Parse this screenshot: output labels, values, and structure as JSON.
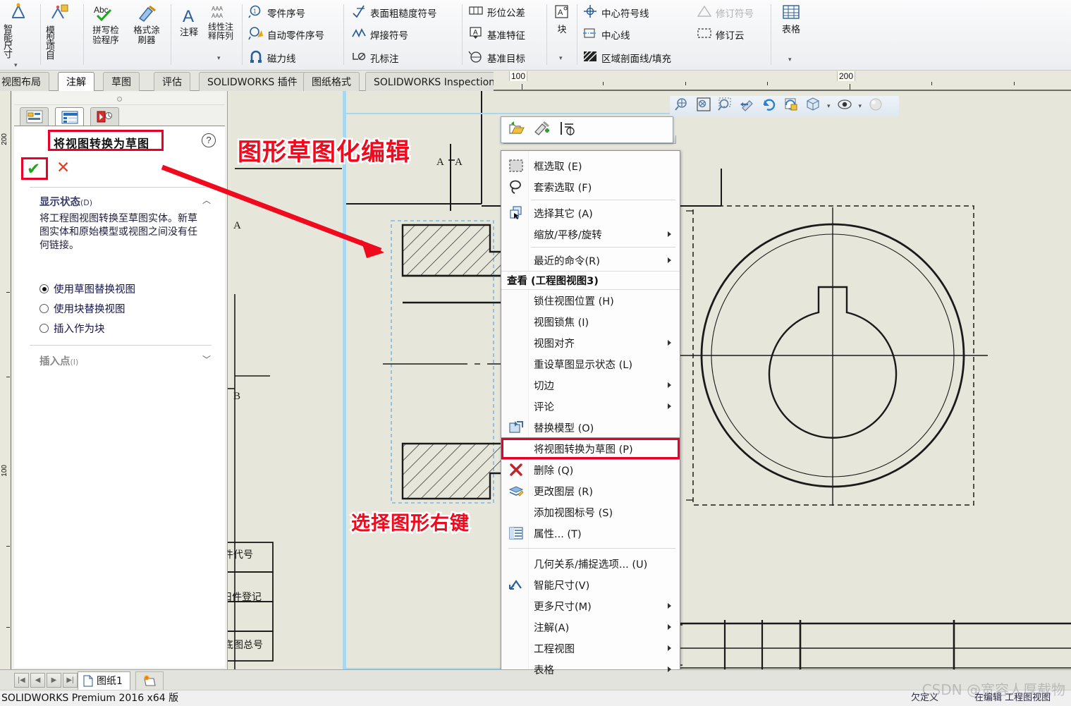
{
  "ribbon": {
    "groups": [
      {
        "label": "智能尺寸",
        "icon": "smart-dimension-icon",
        "has_dropdown": true
      },
      {
        "label": "模型项目",
        "icon": "model-items-icon",
        "has_dropdown": false
      },
      {
        "label": "拼写检验程序",
        "icon": "spell-check-icon",
        "has_dropdown": false
      },
      {
        "label": "格式涂刷器",
        "icon": "format-painter-icon",
        "has_dropdown": false
      },
      {
        "label": "注释",
        "icon": "note-icon",
        "has_dropdown": false
      },
      {
        "label": "线性注释阵列",
        "icon": "linear-note-pattern-icon",
        "has_dropdown": true
      },
      {
        "label": "块",
        "icon": "block-icon",
        "has_dropdown": true
      },
      {
        "label": "表格",
        "icon": "table-icon",
        "has_dropdown": true
      }
    ],
    "commands": [
      {
        "label": "零件序号",
        "icon": "balloon-icon",
        "disabled": false
      },
      {
        "label": "自动零件序号",
        "icon": "auto-balloon-icon",
        "disabled": false
      },
      {
        "label": "磁力线",
        "icon": "magnetic-line-icon",
        "disabled": false
      },
      {
        "label": "表面粗糙度符号",
        "icon": "surface-finish-icon",
        "disabled": false
      },
      {
        "label": "焊接符号",
        "icon": "weld-symbol-icon",
        "disabled": false
      },
      {
        "label": "孔标注",
        "icon": "hole-callout-icon",
        "disabled": false
      },
      {
        "label": "形位公差",
        "icon": "geometric-tolerance-icon",
        "disabled": false
      },
      {
        "label": "基准特征",
        "icon": "datum-feature-icon",
        "disabled": false
      },
      {
        "label": "基准目标",
        "icon": "datum-target-icon",
        "disabled": false
      },
      {
        "label": "中心符号线",
        "icon": "center-mark-icon",
        "disabled": false
      },
      {
        "label": "中心线",
        "icon": "centerline-icon",
        "disabled": false
      },
      {
        "label": "区域剖面线/填充",
        "icon": "area-hatch-fill-icon",
        "disabled": false
      },
      {
        "label": "修订符号",
        "icon": "revision-symbol-icon",
        "disabled": true
      },
      {
        "label": "修订云",
        "icon": "revision-cloud-icon",
        "disabled": false
      }
    ],
    "tabs": [
      {
        "label": "视图布局",
        "active": false
      },
      {
        "label": "注解",
        "active": true
      },
      {
        "label": "草图",
        "active": false
      },
      {
        "label": "评估",
        "active": false
      },
      {
        "label": "SOLIDWORKS 插件",
        "active": false
      },
      {
        "label": "图纸格式",
        "active": false
      },
      {
        "label": "SOLIDWORKS Inspection",
        "active": false
      }
    ]
  },
  "ruler": {
    "horizontal_labels": [
      "100",
      "200"
    ],
    "vertical_labels": [
      "200",
      "100"
    ]
  },
  "property_panel": {
    "tabs": [
      {
        "name": "feature-manager-tab",
        "active": false
      },
      {
        "name": "property-manager-tab",
        "active": true
      },
      {
        "name": "configuration-manager-tab",
        "active": false
      }
    ],
    "title": "将视图转换为草图",
    "help_glyph": "?",
    "ok_glyph": "✔",
    "cancel_glyph": "✕",
    "section_display_state": {
      "label": "显示状态",
      "key": "(D)",
      "description": "将工程图视图转换至草图实体。新草图实体和原始模型或视图之间没有任何链接。",
      "options": [
        {
          "label": "使用草图替换视图",
          "selected": true
        },
        {
          "label": "使用块替换视图",
          "selected": false
        },
        {
          "label": "插入作为块",
          "selected": false
        }
      ]
    },
    "section_insert_point": {
      "label": "插入点",
      "key": "(I)"
    }
  },
  "view_toolbar": {
    "buttons": [
      {
        "name": "zoom-to-area-icon"
      },
      {
        "name": "zoom-to-fit-icon"
      },
      {
        "name": "zoom-to-selection-icon"
      },
      {
        "name": "previous-view-icon"
      },
      {
        "name": "rotate-view-icon"
      },
      {
        "name": "update-view-icon"
      },
      {
        "name": "view-orientation-icon"
      },
      {
        "name": "display-style-icon"
      },
      {
        "name": "hide-show-items-icon"
      },
      {
        "name": "appearance-icon"
      }
    ]
  },
  "mini_toolbar": {
    "buttons": [
      {
        "name": "open-drawing-view-icon"
      },
      {
        "name": "format-painter-icon"
      },
      {
        "name": "align-icon"
      }
    ]
  },
  "context_menu": {
    "items": [
      {
        "label": "框选取 (E)",
        "icon": "box-selection-icon",
        "submenu": false,
        "highlighted": false
      },
      {
        "label": "套索选取 (F)",
        "icon": "lasso-selection-icon",
        "submenu": false,
        "highlighted": false
      },
      {
        "type": "separator"
      },
      {
        "label": "选择其它 (A)",
        "icon": "select-other-icon",
        "submenu": false,
        "highlighted": false
      },
      {
        "label": "缩放/平移/旋转",
        "icon": "",
        "submenu": true,
        "highlighted": false
      },
      {
        "type": "separator"
      },
      {
        "label": "最近的命令(R)",
        "icon": "",
        "submenu": true,
        "highlighted": false
      },
      {
        "type": "header",
        "label": "查看 (工程图视图3)"
      },
      {
        "label": "锁住视图位置 (H)",
        "icon": "",
        "submenu": false,
        "highlighted": false
      },
      {
        "label": "视图锁焦 (I)",
        "icon": "",
        "submenu": false,
        "highlighted": false
      },
      {
        "label": "视图对齐",
        "icon": "",
        "submenu": true,
        "highlighted": false
      },
      {
        "label": "重设草图显示状态 (L)",
        "icon": "",
        "submenu": false,
        "highlighted": false
      },
      {
        "label": "切边",
        "icon": "",
        "submenu": true,
        "highlighted": false
      },
      {
        "label": "评论",
        "icon": "",
        "submenu": true,
        "highlighted": false
      },
      {
        "label": "替换模型 (O)",
        "icon": "replace-model-icon",
        "submenu": false,
        "highlighted": false
      },
      {
        "label": "将视图转换为草图 (P)",
        "icon": "",
        "submenu": false,
        "highlighted": true
      },
      {
        "label": "删除 (Q)",
        "icon": "delete-icon",
        "submenu": false,
        "highlighted": false
      },
      {
        "label": "更改图层 (R)",
        "icon": "change-layer-icon",
        "submenu": false,
        "highlighted": false
      },
      {
        "label": "添加视图标号 (S)",
        "icon": "",
        "submenu": false,
        "highlighted": false
      },
      {
        "label": "属性... (T)",
        "icon": "properties-icon",
        "submenu": false,
        "highlighted": false
      },
      {
        "type": "separator"
      },
      {
        "label": "几何关系/捕捉选项... (U)",
        "icon": "",
        "submenu": false,
        "highlighted": false
      },
      {
        "label": "智能尺寸(V)",
        "icon": "smart-dimension-icon",
        "submenu": false,
        "highlighted": false
      },
      {
        "label": "更多尺寸(M)",
        "icon": "",
        "submenu": true,
        "highlighted": false
      },
      {
        "label": "注解(A)",
        "icon": "",
        "submenu": true,
        "highlighted": false
      },
      {
        "label": "工程视图",
        "icon": "",
        "submenu": true,
        "highlighted": false
      },
      {
        "label": "表格",
        "icon": "",
        "submenu": true,
        "highlighted": false
      }
    ]
  },
  "annotations": {
    "headline": "图形草图化编辑",
    "callout": "选择图形右键"
  },
  "drawing": {
    "section_label": "A—A",
    "datum_letters": [
      "A",
      "B"
    ],
    "title_block_fields": [
      "件代号",
      "旧件登记",
      "底图总号"
    ]
  },
  "sheet_tabs": {
    "nav_glyphs": [
      "|◀",
      "◀",
      "▶",
      "▶|"
    ],
    "active_sheet": "图纸1",
    "add_sheet_icon": "add-sheet-icon"
  },
  "status_bar": {
    "left_text": "SOLIDWORKS Premium 2016 x64 版",
    "state_text": "欠定义",
    "edit_text": "在编辑 工程图视图",
    "watermark": "CSDN @宽容人厚载物"
  },
  "colors": {
    "accent_red": "#ef0a1e",
    "sheet_bg": "#e6e6da",
    "panel_bg": "#ffffff",
    "highlight_blue": "#a7d8ef"
  }
}
